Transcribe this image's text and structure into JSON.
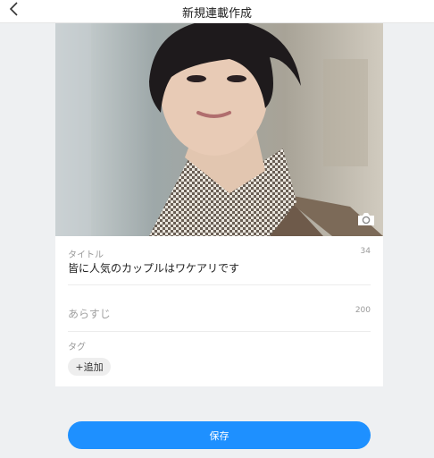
{
  "header": {
    "title": "新規連載作成"
  },
  "form": {
    "title": {
      "label": "タイトル",
      "counter": "34",
      "value": "皆に人気のカップルはワケアリです"
    },
    "synopsis": {
      "placeholder": "あらすじ",
      "counter": "200"
    },
    "tags": {
      "label": "タグ",
      "add_label": "+追加"
    }
  },
  "save_label": "保存",
  "colors": {
    "accent": "#1e90ff",
    "background": "#eef0f2",
    "card": "#ffffff"
  },
  "icons": {
    "back": "chevron-left-icon",
    "camera": "camera-icon"
  }
}
